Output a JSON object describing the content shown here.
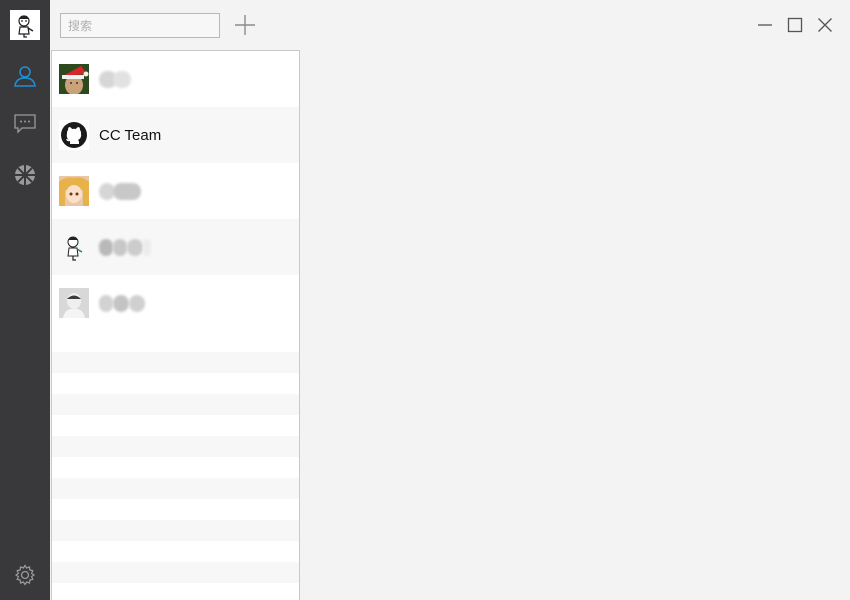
{
  "search": {
    "placeholder": "搜索"
  },
  "toolbar": {
    "add_icon": "plus-icon"
  },
  "window": {
    "minimize_icon": "minimize-icon",
    "maximize_icon": "maximize-icon",
    "close_icon": "close-icon"
  },
  "rail": {
    "items": [
      {
        "icon": "contacts-icon",
        "active": true
      },
      {
        "icon": "chat-bubble-icon",
        "active": false
      },
      {
        "icon": "moments-icon",
        "active": false
      }
    ],
    "settings_icon": "gear-icon"
  },
  "contacts": [
    {
      "name": "",
      "blurred": true,
      "avatar": "santa-hat-man"
    },
    {
      "name": "CC Team",
      "blurred": false,
      "avatar": "github-logo"
    },
    {
      "name": "",
      "blurred": true,
      "avatar": "anime-girl"
    },
    {
      "name": "",
      "blurred": true,
      "avatar": "cartoon-man"
    },
    {
      "name": "",
      "blurred": true,
      "avatar": "bald-man"
    }
  ],
  "colors": {
    "rail_bg": "#39393c",
    "accent": "#1e90d6",
    "app_bg": "#f3f3f3"
  }
}
